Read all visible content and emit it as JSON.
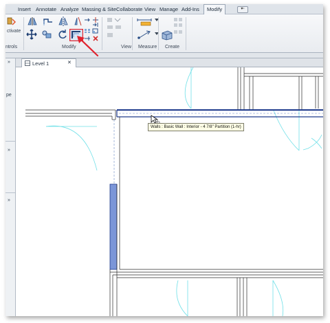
{
  "ribbon": {
    "tabs": [
      {
        "id": "insert",
        "label": "Insert"
      },
      {
        "id": "annotate",
        "label": "Annotate"
      },
      {
        "id": "analyze",
        "label": "Analyze"
      },
      {
        "id": "massing",
        "label": "Massing & Site"
      },
      {
        "id": "collaborate",
        "label": "Collaborate"
      },
      {
        "id": "view",
        "label": "View"
      },
      {
        "id": "manage",
        "label": "Manage"
      },
      {
        "id": "addins",
        "label": "Add-Ins"
      },
      {
        "id": "modify",
        "label": "Modify",
        "active": true
      }
    ],
    "panels": {
      "activate": "ctivate",
      "controls": "ntrols",
      "modify": "Modify",
      "view": "View",
      "measure": "Measure",
      "create": "Create"
    }
  },
  "left_panel": {
    "marks": [
      "»",
      "pe",
      "»",
      "»"
    ]
  },
  "view_tabs": [
    {
      "label": "Level 1",
      "close": "✕"
    }
  ],
  "canvas": {
    "tooltip": "Walls : Basic Wall : Interior - 4 7/8\" Partition (1-hr)"
  },
  "colors": {
    "highlight_red": "#e0232e",
    "wall_selected": "#1e3a8c",
    "wall_fill_blue": "#7b96d8",
    "door_cyan": "#6fe0e8",
    "ribbon_bg": "#eceff3"
  }
}
